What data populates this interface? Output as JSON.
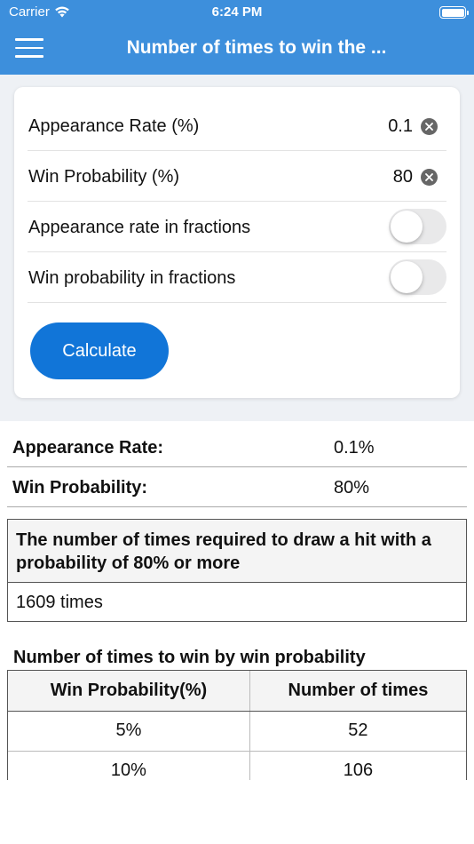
{
  "status_bar": {
    "carrier": "Carrier",
    "time": "6:24 PM",
    "battery_level": 1.0
  },
  "nav": {
    "title": "Number of times to win the ...",
    "menu_icon": "hamburger-icon"
  },
  "form": {
    "appearance_rate": {
      "label": "Appearance Rate (%)",
      "value": "0.1"
    },
    "win_probability": {
      "label": "Win Probability (%)",
      "value": "80"
    },
    "appearance_fraction": {
      "label": "Appearance rate in fractions",
      "on": false
    },
    "win_fraction": {
      "label": "Win probability in fractions",
      "on": false
    },
    "calculate_label": "Calculate"
  },
  "summary": {
    "appearance_rate": {
      "label": "Appearance Rate:",
      "value": "0.1%"
    },
    "win_probability": {
      "label": "Win Probability:",
      "value": "80%"
    }
  },
  "result": {
    "heading": "The number of times required to draw a hit with a probability of 80% or more",
    "value": "1609 times"
  },
  "table": {
    "title": "Number of times to win by win probability",
    "headers": [
      "Win Probability(%)",
      "Number of times"
    ],
    "rows": [
      [
        "5%",
        "52"
      ],
      [
        "10%",
        "106"
      ],
      [
        "",
        ""
      ]
    ]
  },
  "colors": {
    "header": "#3d8fdc",
    "button": "#1175d8",
    "background": "#eef1f5"
  }
}
